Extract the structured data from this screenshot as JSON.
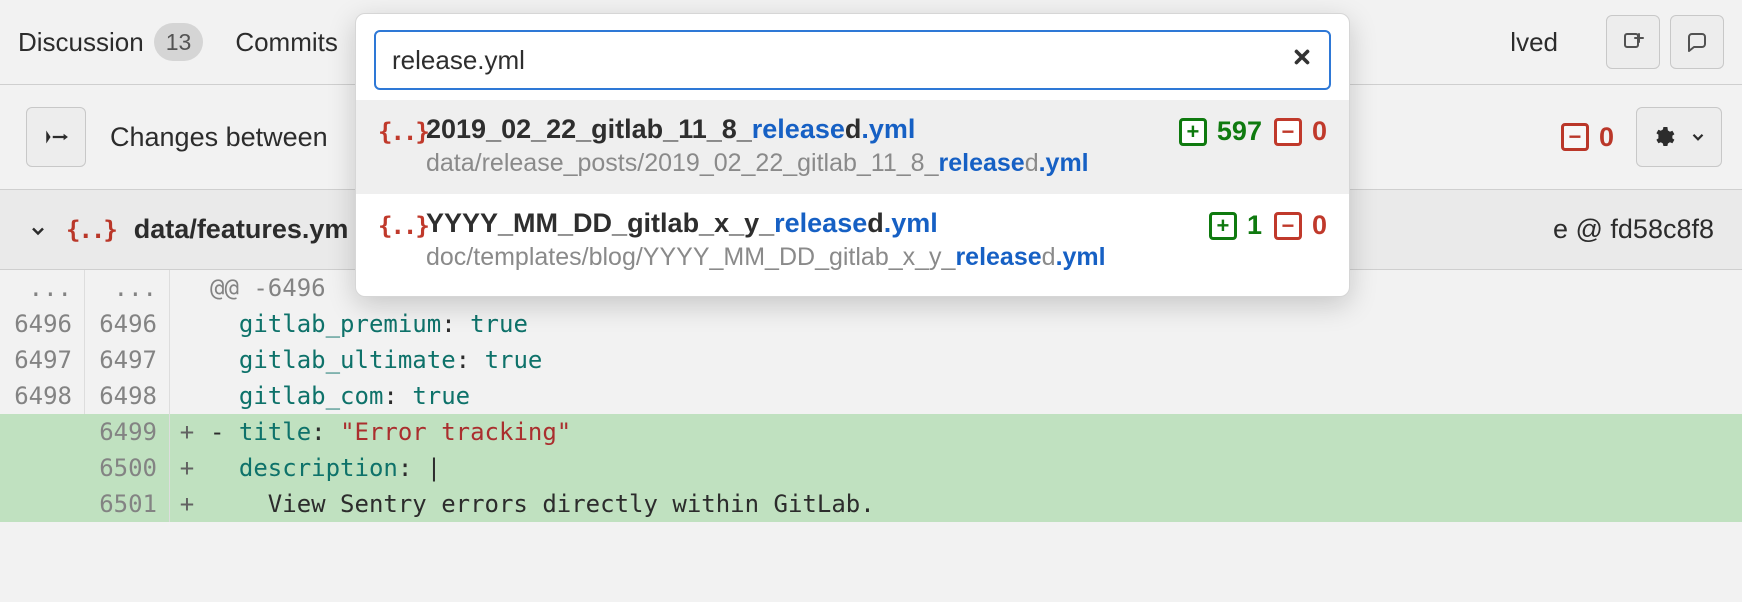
{
  "tabs": {
    "discussion_label": "Discussion",
    "discussion_count": "13",
    "commits_label": "Commits"
  },
  "header_right": {
    "resolved_suffix": "lved"
  },
  "changes_bar": {
    "label": "Changes between",
    "minus": "0"
  },
  "gear": {},
  "file_header": {
    "path": "data/features.ym",
    "view_at_prefix": "e @ ",
    "commit": "fd58c8f8"
  },
  "diff": {
    "hunk": "@@ -6496",
    "rows": [
      {
        "old": "6496",
        "new": "6496",
        "sign": " ",
        "kind": "ctx",
        "key": "gitlab_premium",
        "val": "true"
      },
      {
        "old": "6497",
        "new": "6497",
        "sign": " ",
        "kind": "ctx",
        "key": "gitlab_ultimate",
        "val": "true"
      },
      {
        "old": "6498",
        "new": "6498",
        "sign": " ",
        "kind": "ctx",
        "key": "gitlab_com",
        "val": "true"
      },
      {
        "old": "",
        "new": "6499",
        "sign": "+",
        "kind": "add",
        "raw_html": "- <span class=\"tok-key\">title</span>: <span class=\"tok-str\">\"Error tracking\"</span>"
      },
      {
        "old": "",
        "new": "6500",
        "sign": "+",
        "kind": "add",
        "raw_html": "  <span class=\"tok-key\">description</span>: |"
      },
      {
        "old": "",
        "new": "6501",
        "sign": "+",
        "kind": "add",
        "raw_html": "    <span class=\"tok-plain\">View Sentry errors directly within GitLab.</span>"
      }
    ]
  },
  "popover": {
    "search_value": "release.yml",
    "results": [
      {
        "active": true,
        "title_pre": "2019_02_22_gitlab_11_8_",
        "title_hit": "release",
        "title_post": "d",
        "title_ext": ".yml",
        "path_pre": "data/release_posts/2019_02_22_gitlab_11_8_",
        "path_hit": "release",
        "path_post": "d",
        "path_ext": ".yml",
        "added": "597",
        "removed": "0"
      },
      {
        "active": false,
        "title_pre": "YYYY_MM_DD_gitlab_x_y_",
        "title_hit": "release",
        "title_post": "d",
        "title_ext": ".yml",
        "path_pre": "doc/templates/blog/YYYY_MM_DD_gitlab_x_y_",
        "path_hit": "release",
        "path_post": "d",
        "path_ext": ".yml",
        "added": "1",
        "removed": "0"
      }
    ]
  }
}
